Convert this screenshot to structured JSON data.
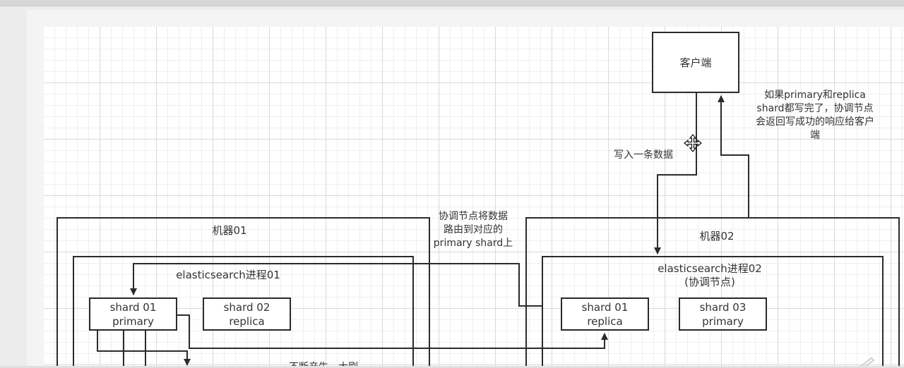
{
  "client": {
    "label": "客户端"
  },
  "edges": {
    "write_one": "写入一条数据",
    "route": [
      "协调节点将数据",
      "路由到对应的",
      "primary shard上"
    ],
    "response": [
      "如果primary和replica",
      "shard都写完了，协调节点",
      "会返回写成功的响应给客户",
      "端"
    ],
    "partial_left": "不断产生，大刷",
    "partial_mid": "..."
  },
  "machine01": {
    "label": "机器01",
    "process": {
      "label": "elasticsearch进程01"
    },
    "shards": [
      {
        "name": "shard 01",
        "role": "primary"
      },
      {
        "name": "shard 02",
        "role": "replica"
      }
    ]
  },
  "machine02": {
    "label": "机器02",
    "process": {
      "label": "elasticsearch进程02",
      "note": "(协调节点)"
    },
    "shards": [
      {
        "name": "shard 01",
        "role": "replica"
      },
      {
        "name": "shard 03",
        "role": "primary"
      }
    ]
  },
  "colors": {
    "stroke": "#2b2b2b",
    "text": "#333333",
    "grid": "#d9d9d9"
  },
  "icons": [
    "move-cursor-icon",
    "pen-icon"
  ]
}
